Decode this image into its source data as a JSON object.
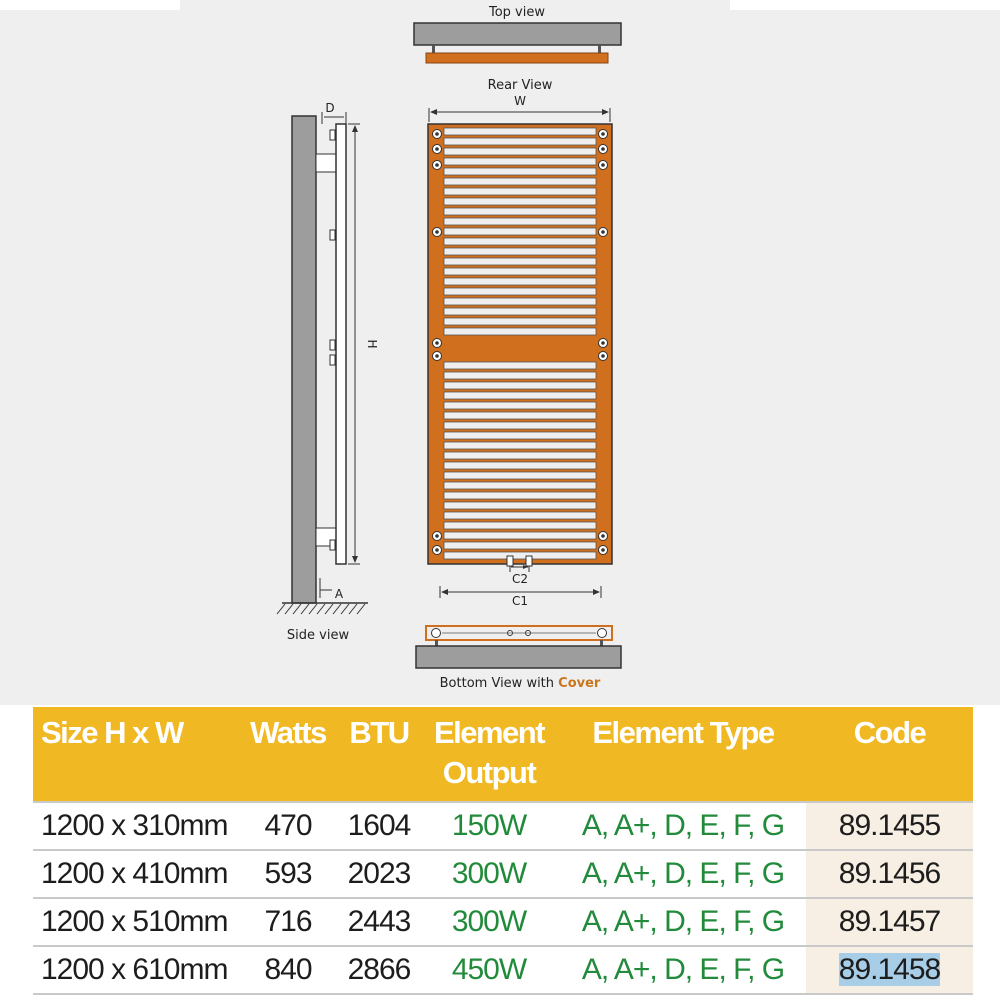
{
  "diagram": {
    "labels": {
      "top_view": "Top view",
      "rear_view": "Rear View",
      "side_view": "Side view",
      "bottom_view_prefix": "Bottom View with ",
      "bottom_view_cover": "Cover",
      "dim_w": "W",
      "dim_h": "H",
      "dim_d": "D",
      "dim_a": "A",
      "dim_c1": "C1",
      "dim_c2": "C2"
    },
    "colors": {
      "frame_orange": "#d06f1e",
      "wall_grey": "#9d9d9d",
      "outline": "#333333",
      "cover_text": "#c8761e"
    }
  },
  "table": {
    "headers": {
      "size": "Size H x W",
      "watts": "Watts",
      "btu": "BTU",
      "element_output_line1": "Element",
      "element_output_line2": "Output",
      "element_type": "Element Type",
      "code": "Code"
    },
    "rows": [
      {
        "size": "1200 x 310mm",
        "watts": "470",
        "btu": "1604",
        "output": "150W",
        "type": "A, A+, D, E, F, G",
        "code": "89.1455"
      },
      {
        "size": "1200 x 410mm",
        "watts": "593",
        "btu": "2023",
        "output": "300W",
        "type": "A, A+, D, E, F, G",
        "code": "89.1456"
      },
      {
        "size": "1200 x 510mm",
        "watts": "716",
        "btu": "2443",
        "output": "300W",
        "type": "A, A+, D, E, F, G",
        "code": "89.1457"
      },
      {
        "size": "1200 x 610mm",
        "watts": "840",
        "btu": "2866",
        "output": "450W",
        "type": "A, A+, D, E, F, G",
        "code": "89.1458"
      }
    ],
    "colors": {
      "header_bg": "#f0b823",
      "header_text": "#ffffff",
      "green_text": "#228b3b",
      "code_bg": "#f7efe4",
      "selection_highlight": "#a8cde7"
    }
  }
}
